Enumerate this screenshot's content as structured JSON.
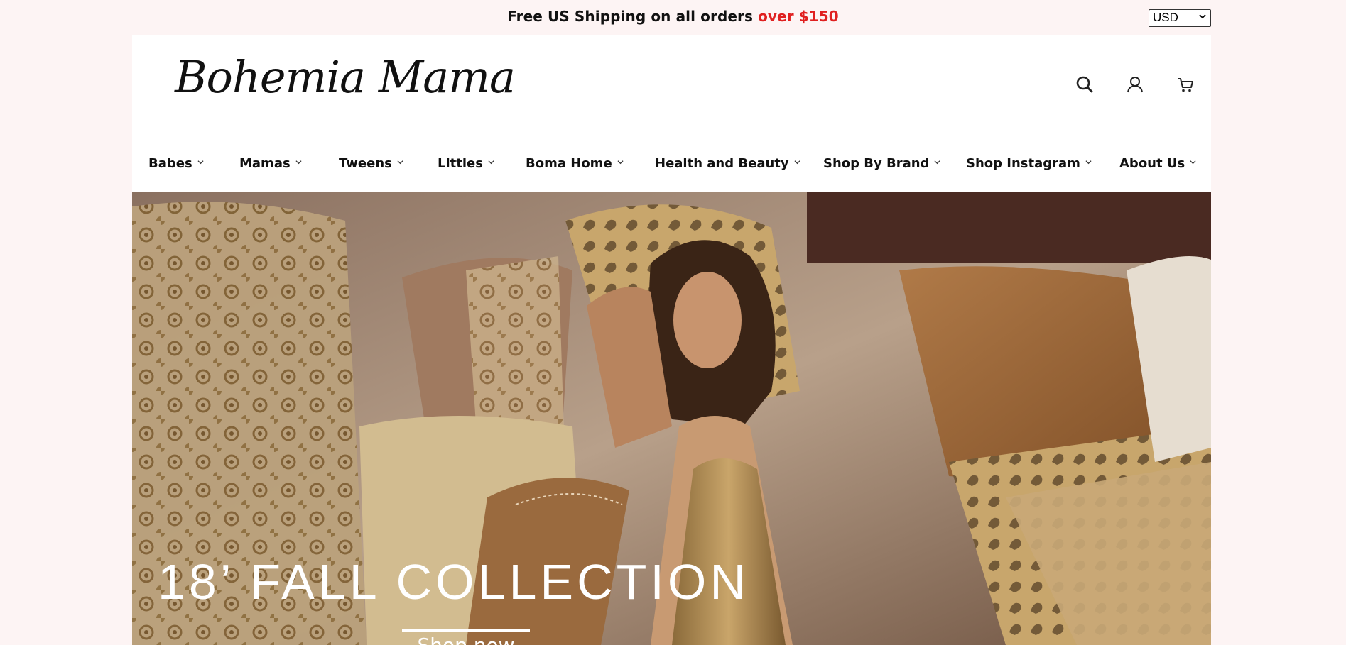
{
  "announcement": {
    "text": "Free US Shipping on all orders ",
    "highlight": "over $150",
    "highlight_color": "#e02020"
  },
  "currency": {
    "selected": "USD"
  },
  "brand": {
    "logo_text": "Bohemia Mama"
  },
  "header_icons": [
    "search-icon",
    "account-icon",
    "cart-icon"
  ],
  "nav": {
    "items": [
      {
        "label": "Babes"
      },
      {
        "label": "Mamas"
      },
      {
        "label": "Tweens"
      },
      {
        "label": "Littles"
      },
      {
        "label": "Boma Home"
      },
      {
        "label": "Health and Beauty"
      },
      {
        "label": "Shop By Brand"
      },
      {
        "label": "Shop Instagram"
      },
      {
        "label": "About Us"
      }
    ]
  },
  "hero": {
    "title": "18’ FALL COLLECTION",
    "cta": "Shop now"
  },
  "colors": {
    "page_bg": "#fdf4f4",
    "header_bg": "#ffffff",
    "text": "#111111"
  }
}
